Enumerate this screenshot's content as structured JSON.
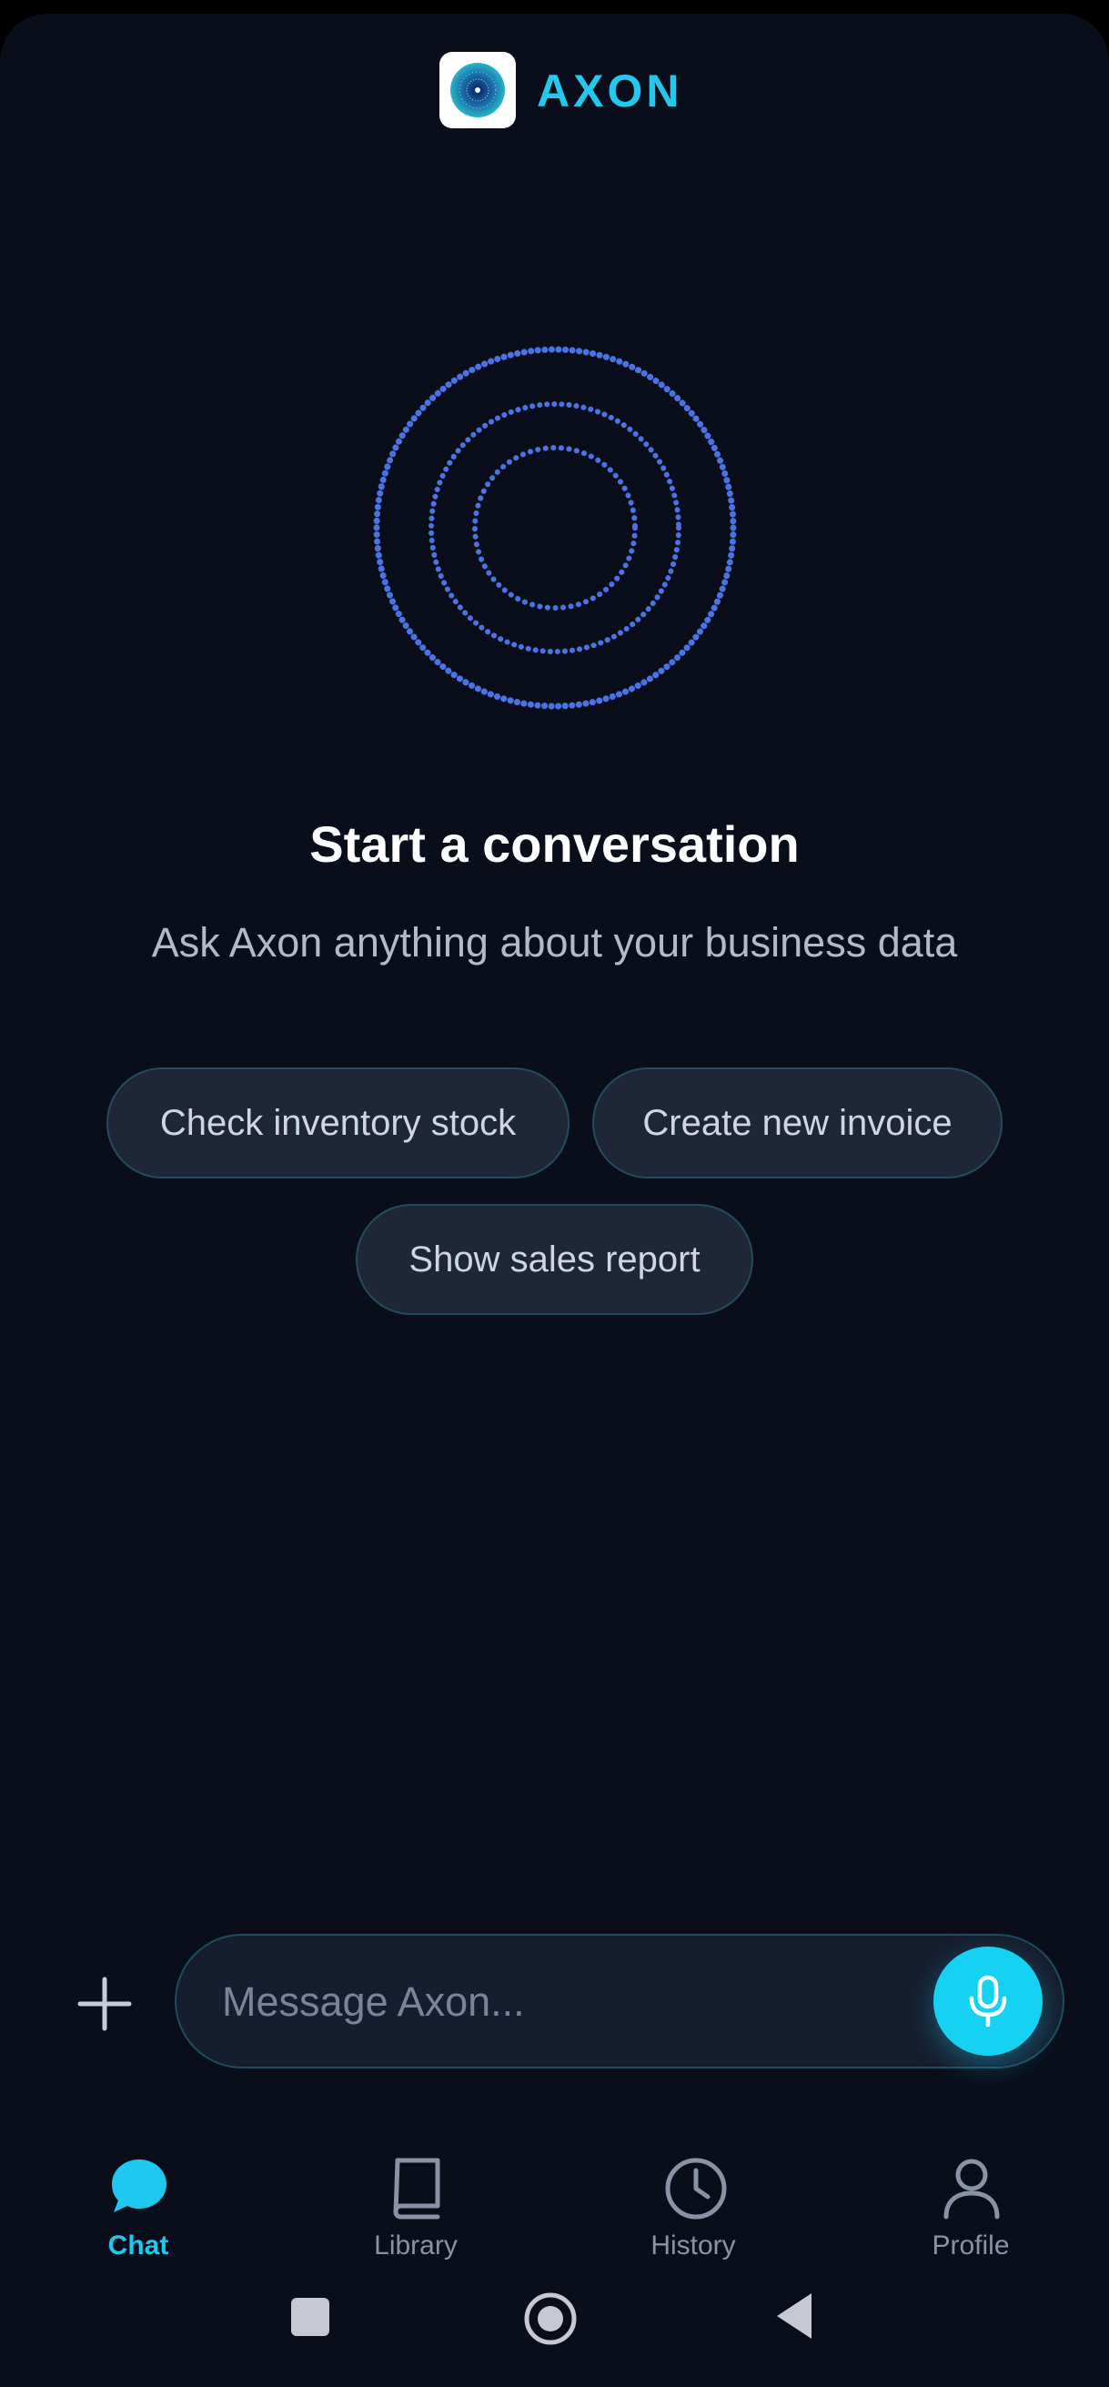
{
  "app": {
    "brand": "AXON",
    "accent_color": "#22c9ef",
    "background_color": "#0a0e1a"
  },
  "empty_state": {
    "title": "Start a conversation",
    "subtitle": "Ask Axon anything about your business data"
  },
  "suggestions": [
    {
      "label": "Check inventory stock"
    },
    {
      "label": "Create new invoice"
    },
    {
      "label": "Show sales report"
    }
  ],
  "composer": {
    "placeholder": "Message Axon...",
    "value": "",
    "attach_icon": "plus-icon",
    "voice_icon": "microphone-icon"
  },
  "nav": {
    "active": "Chat",
    "items": [
      {
        "label": "Chat",
        "icon": "chat-bubble-icon"
      },
      {
        "label": "Library",
        "icon": "book-icon"
      },
      {
        "label": "History",
        "icon": "clock-icon"
      },
      {
        "label": "Profile",
        "icon": "person-icon"
      }
    ]
  },
  "system_nav": {
    "icons": [
      "recents-square-icon",
      "home-circle-icon",
      "back-triangle-icon"
    ]
  }
}
